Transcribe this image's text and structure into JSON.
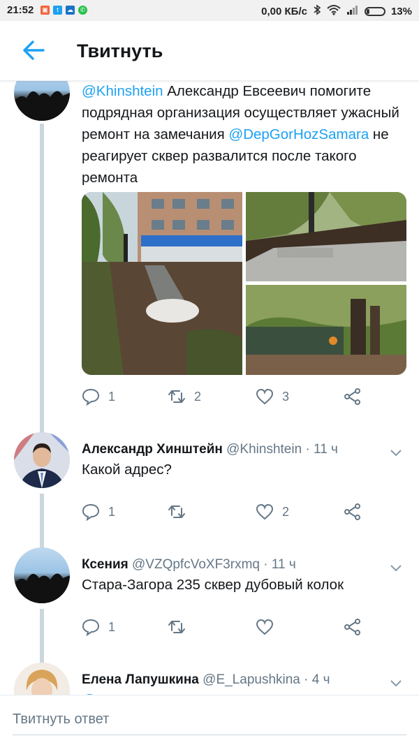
{
  "status_bar": {
    "time": "21:52",
    "network_speed": "0,00 КБ/с",
    "battery": "13%",
    "icons": [
      "sim-icon",
      "twitter-icon",
      "cloud-icon",
      "whatsapp-icon",
      "bluetooth-icon",
      "wifi-icon",
      "signal-icon",
      "battery-icon"
    ]
  },
  "header": {
    "title": "Твитнуть",
    "back_icon": "arrow-left-icon"
  },
  "tweets": [
    {
      "text_parts": [
        {
          "type": "mention",
          "text": "@Khinshtein"
        },
        {
          "type": "text",
          "text": " Александр Евсеевич помогите подрядная организация осуществляет ужасный ремонт на замечания "
        },
        {
          "type": "mention",
          "text": "@DepGorHozSamara"
        },
        {
          "type": "text",
          "text": "  не реагирует сквер развалится после такого ремонта"
        }
      ],
      "photos": [
        "photo-building-dirt-path",
        "photo-willow-sidewalk",
        "photo-willow-pond"
      ],
      "reply_count": "1",
      "retweet_count": "2",
      "like_count": "3"
    },
    {
      "name": "Александр Хинштейн",
      "handle": "@Khinshtein",
      "time": "· 11 ч",
      "text": "Какой адрес?",
      "reply_count": "1",
      "retweet_count": "",
      "like_count": "2"
    },
    {
      "name": "Ксения",
      "handle": "@VZQpfcVoXF3rxmq",
      "time": "· 11 ч",
      "text": "Стара-Загора 235 сквер дубовый колок",
      "reply_count": "1",
      "retweet_count": "",
      "like_count": ""
    },
    {
      "name": "Елена Лапушкина",
      "handle": "@E_Lapushkina",
      "time": "· 4 ч",
      "text": "@DepGorHozSamara"
    }
  ],
  "reply_placeholder": "Твитнуть ответ",
  "colors": {
    "accent": "#1da1f2",
    "text": "#14171a",
    "muted": "#657786"
  }
}
